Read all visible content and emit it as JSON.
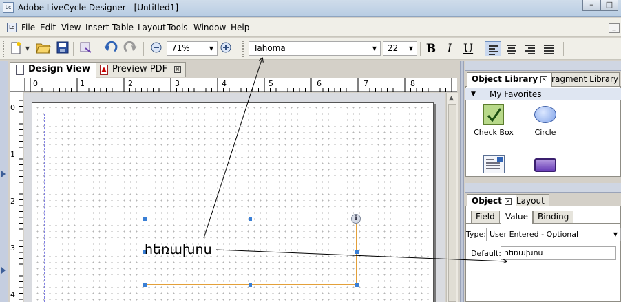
{
  "window": {
    "title": "Adobe LiveCycle Designer - [Untitled1]",
    "app_icon": "Lc",
    "controls": [
      "–",
      "□"
    ]
  },
  "menubar": {
    "items": [
      "File",
      "Edit",
      "View",
      "Insert",
      "Table",
      "Layout",
      "Tools",
      "Window",
      "Help"
    ],
    "min_glyph": "_"
  },
  "toolbar": {
    "zoom": "71%",
    "font_family": "Tahoma",
    "font_size": "22",
    "bold": "B",
    "italic": "I",
    "underline": "U"
  },
  "tabs": {
    "design_view": "Design View",
    "preview_pdf": "Preview PDF"
  },
  "rulers": {
    "h_ticks": [
      "0",
      "1",
      "2",
      "3",
      "4",
      "5",
      "6",
      "7",
      "8"
    ],
    "v_ticks": [
      "0",
      "1",
      "2",
      "3",
      "4"
    ]
  },
  "canvas": {
    "field_text": "hեռախոս",
    "info_glyph": "i"
  },
  "library": {
    "tab_object_library": "Object Library",
    "tab_fragment_library": "Fragment Library",
    "group": "My Favorites",
    "items": [
      "Check Box",
      "Circle"
    ]
  },
  "object_panel": {
    "tab_object": "Object",
    "tab_layout": "Layout",
    "subtabs": [
      "Field",
      "Value",
      "Binding"
    ],
    "type_label": "Type:",
    "type_value": "User Entered - Optional",
    "default_label": "Default:",
    "default_value": "hեռախոս"
  }
}
